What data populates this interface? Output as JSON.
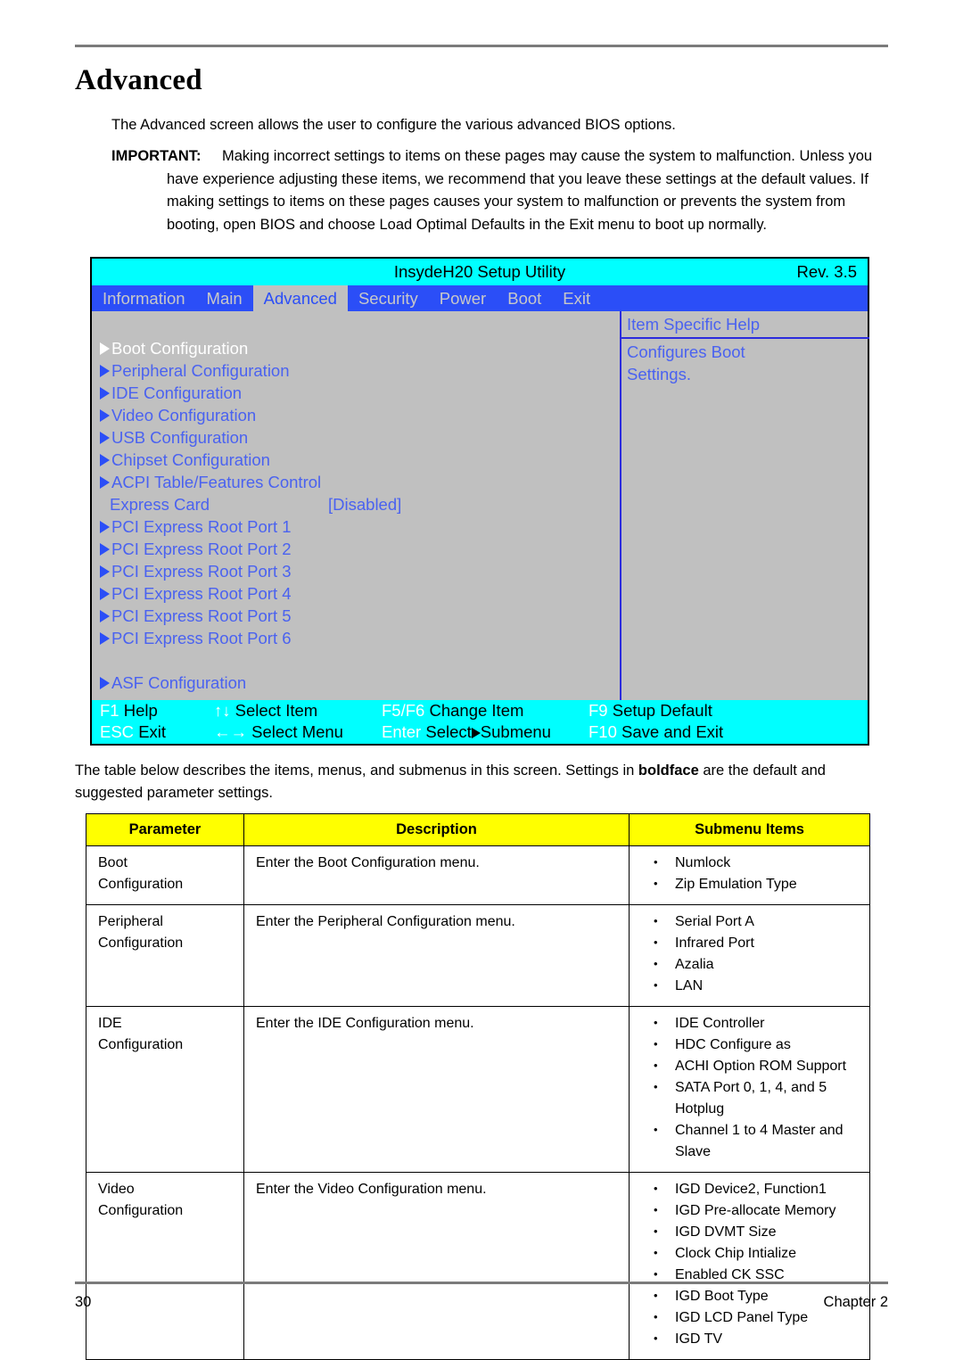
{
  "page": {
    "title": "Advanced",
    "intro": "The Advanced screen allows the user to configure the various advanced BIOS options.",
    "important_label": "IMPORTANT:",
    "important_body": "Making incorrect settings to items on these pages may cause the system to malfunction. Unless you have experience adjusting these items, we recommend that you leave these settings at the default values. If making settings to items on these pages causes your system to malfunction or prevents the system from booting, open BIOS and choose Load Optimal Defaults in the Exit menu to boot up normally.",
    "table_intro_pre": "The table below describes the items, menus, and submenus in this screen. Settings in ",
    "table_intro_bold": "boldface",
    "table_intro_post": " are the default and suggested parameter settings.",
    "page_number": "30",
    "chapter": "Chapter 2"
  },
  "bios": {
    "utility_title": "InsydeH20 Setup Utility",
    "revision": "Rev. 3.5",
    "menu_tabs": [
      {
        "label": "Information",
        "active": false
      },
      {
        "label": "Main",
        "active": false
      },
      {
        "label": "Advanced",
        "active": true
      },
      {
        "label": "Security",
        "active": false
      },
      {
        "label": "Power",
        "active": false
      },
      {
        "label": "Boot",
        "active": false
      },
      {
        "label": "Exit",
        "active": false
      }
    ],
    "help": {
      "title": "Item Specific Help",
      "line1": "Configures Boot",
      "line2": "Settings."
    },
    "items": [
      {
        "label": "Boot Configuration",
        "submenu": true,
        "value": "",
        "selected": true
      },
      {
        "label": "Peripheral Configuration",
        "submenu": true,
        "value": "",
        "selected": false
      },
      {
        "label": "IDE Configuration",
        "submenu": true,
        "value": "",
        "selected": false
      },
      {
        "label": "Video Configuration",
        "submenu": true,
        "value": "",
        "selected": false
      },
      {
        "label": "USB Configuration",
        "submenu": true,
        "value": "",
        "selected": false
      },
      {
        "label": "Chipset Configuration",
        "submenu": true,
        "value": "",
        "selected": false
      },
      {
        "label": "ACPI Table/Features Control",
        "submenu": true,
        "value": "",
        "selected": false
      },
      {
        "label": "Express Card",
        "submenu": false,
        "value": "[Disabled]",
        "selected": false
      },
      {
        "label": "PCI Express Root Port 1",
        "submenu": true,
        "value": "",
        "selected": false
      },
      {
        "label": "PCI Express Root Port 2",
        "submenu": true,
        "value": "",
        "selected": false
      },
      {
        "label": "PCI Express Root Port 3",
        "submenu": true,
        "value": "",
        "selected": false
      },
      {
        "label": "PCI Express Root Port 4",
        "submenu": true,
        "value": "",
        "selected": false
      },
      {
        "label": "PCI Express Root Port 5",
        "submenu": true,
        "value": "",
        "selected": false
      },
      {
        "label": "PCI Express Root Port 6",
        "submenu": true,
        "value": "",
        "selected": false
      },
      {
        "label": "",
        "submenu": false,
        "value": "",
        "selected": false
      },
      {
        "label": "ASF Configuration",
        "submenu": true,
        "value": "",
        "selected": false
      }
    ],
    "footer": {
      "row1": [
        {
          "key": "F1",
          "text": "Help"
        },
        {
          "key": "↑↓",
          "text": "Select Item"
        },
        {
          "key": "F5/F6",
          "text": "Change Item"
        },
        {
          "key": "F9",
          "text": "Setup Default"
        }
      ],
      "row2": [
        {
          "key": "ESC",
          "text": "Exit"
        },
        {
          "key": "←→",
          "text": "Select Menu"
        },
        {
          "key": "Enter",
          "text": "Select",
          "text2": "Submenu",
          "triangle": true
        },
        {
          "key": "F10",
          "text": "Save and Exit"
        }
      ]
    }
  },
  "table": {
    "headers": [
      "Parameter",
      "Description",
      "Submenu Items"
    ],
    "rows": [
      {
        "parameter": "Boot\nConfiguration",
        "description": "Enter the Boot Configuration menu.",
        "submenu_items": [
          "Numlock",
          "Zip Emulation Type"
        ]
      },
      {
        "parameter": "Peripheral\nConfiguration",
        "description": "Enter the Peripheral Configuration menu.",
        "submenu_items": [
          "Serial Port A",
          "Infrared Port",
          "Azalia",
          "LAN"
        ]
      },
      {
        "parameter": "IDE\nConfiguration",
        "description": "Enter the IDE Configuration menu.",
        "submenu_items": [
          "IDE Controller",
          "HDC Configure as",
          "ACHI Option ROM Support",
          "SATA Port 0, 1, 4, and 5 Hotplug",
          "Channel 1 to 4 Master and Slave"
        ]
      },
      {
        "parameter": "Video\nConfiguration",
        "description": "Enter the Video Configuration menu.",
        "submenu_items": [
          "IGD Device2, Function1",
          "IGD Pre-allocate Memory",
          "IGD DVMT Size",
          "Clock Chip Intialize",
          "Enabled CK SSC",
          "IGD Boot Type",
          "IGD LCD Panel Type",
          "IGD TV"
        ]
      }
    ]
  },
  "colors": {
    "bios_titlebar": "#00ffff",
    "bios_menubar": "#2b4ef7",
    "bios_body": "#c0c0c0",
    "bios_text": "#4a62f0",
    "table_header": "#ffff00",
    "rule": "#7b7b7b"
  }
}
